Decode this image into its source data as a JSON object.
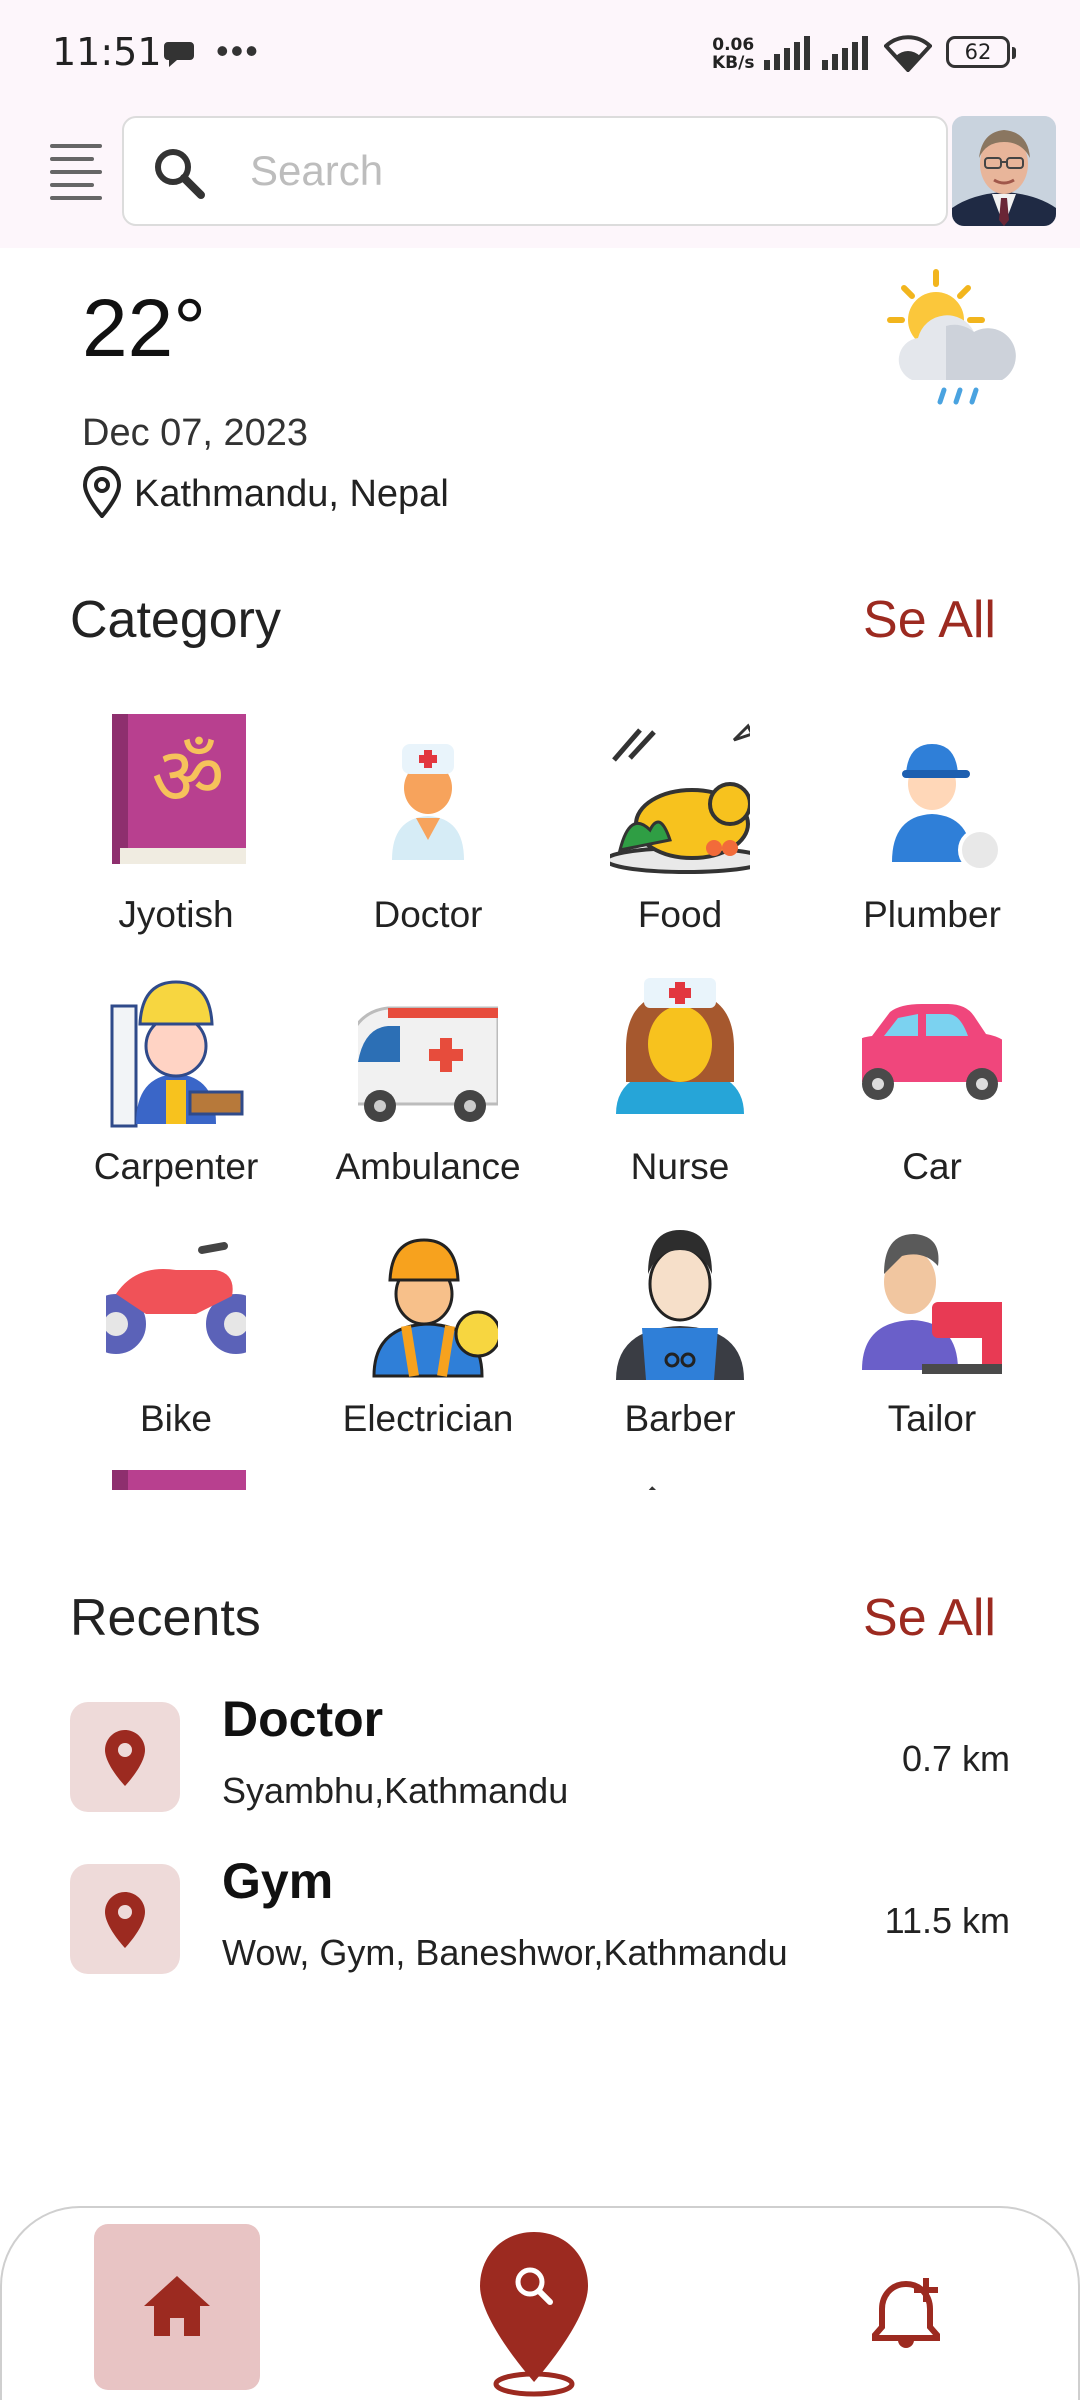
{
  "status_bar": {
    "time": "11:51",
    "net_speed_value": "0.06",
    "net_speed_unit": "KB/s",
    "battery": "62"
  },
  "header": {
    "search_placeholder": "Search"
  },
  "weather": {
    "temperature": "22°",
    "date": "Dec 07, 2023",
    "location": "Kathmandu, Nepal"
  },
  "category": {
    "title": "Category",
    "see_all": "Se All",
    "items": [
      {
        "label": "Jyotish",
        "icon": "om-book-icon"
      },
      {
        "label": "Doctor",
        "icon": "doctor-icon"
      },
      {
        "label": "Food",
        "icon": "food-icon"
      },
      {
        "label": "Plumber",
        "icon": "plumber-icon"
      },
      {
        "label": "Carpenter",
        "icon": "carpenter-icon"
      },
      {
        "label": "Ambulance",
        "icon": "ambulance-icon"
      },
      {
        "label": "Nurse",
        "icon": "nurse-icon"
      },
      {
        "label": "Car",
        "icon": "car-icon"
      },
      {
        "label": "Bike",
        "icon": "bike-icon"
      },
      {
        "label": "Electrician",
        "icon": "electrician-icon"
      },
      {
        "label": "Barber",
        "icon": "barber-icon"
      },
      {
        "label": "Tailor",
        "icon": "tailor-icon"
      }
    ]
  },
  "recents": {
    "title": "Recents",
    "see_all": "Se All",
    "items": [
      {
        "title": "Doctor",
        "address": "Syambhu,Kathmandu",
        "distance": "0.7 km"
      },
      {
        "title": "Gym",
        "address": "Wow, Gym, Baneshwor,Kathmandu",
        "distance": "11.5 km"
      }
    ]
  },
  "colors": {
    "accent": "#9c2a20",
    "pin_bg": "#eedad9",
    "home_active_bg": "#e8c4c4",
    "header_bg": "#fdf6fb"
  }
}
